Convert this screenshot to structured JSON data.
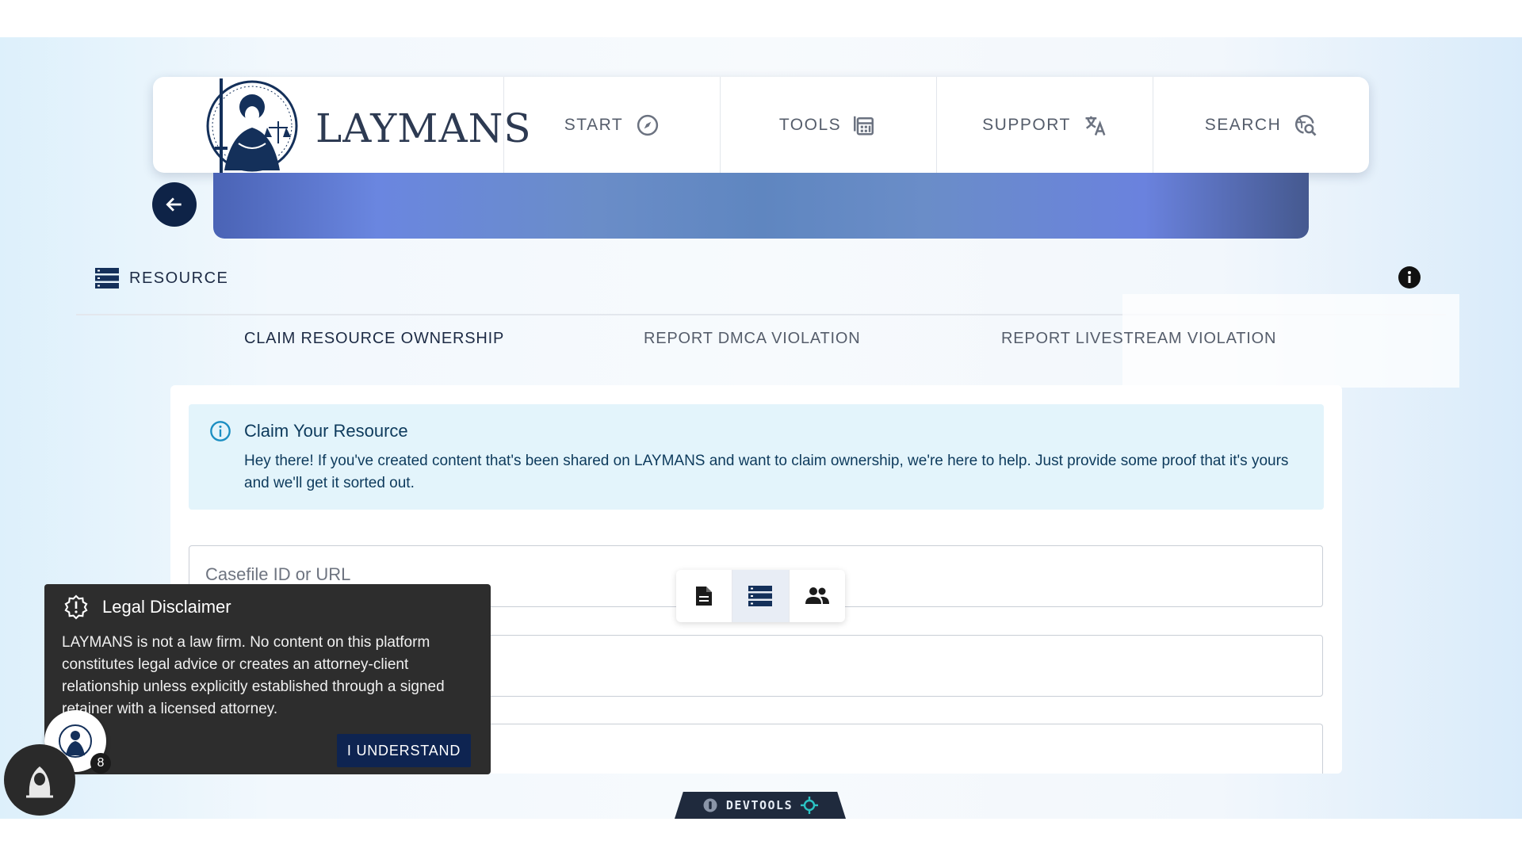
{
  "app": {
    "logo_text": "LAYMANS"
  },
  "nav": [
    {
      "label": "START",
      "icon": "compass-icon"
    },
    {
      "label": "TOOLS",
      "icon": "calculator-icon"
    },
    {
      "label": "SUPPORT",
      "icon": "translate-icon"
    },
    {
      "label": "SEARCH",
      "icon": "search-globe-icon"
    }
  ],
  "resource": {
    "title": "RESOURCE"
  },
  "tabs": [
    {
      "label": "CLAIM RESOURCE OWNERSHIP",
      "active": true
    },
    {
      "label": "REPORT DMCA VIOLATION",
      "active": false
    },
    {
      "label": "REPORT LIVESTREAM VIOLATION",
      "active": false
    }
  ],
  "alert": {
    "title": "Claim Your Resource",
    "body": "Hey there! If you've created content that's been shared on LAYMANS and want to claim ownership, we're here to help. Just provide some proof that it's yours and we'll get it sorted out."
  },
  "form": {
    "casefile_placeholder": "Casefile ID or URL",
    "field2_value": "",
    "field3_value": ""
  },
  "toggle": {
    "options": [
      "document-icon",
      "list-icon",
      "people-icon"
    ],
    "selected": 1
  },
  "disclaimer": {
    "title": "Legal Disclaimer",
    "body": "LAYMANS is not a law firm. No content on this platform constitutes legal advice or creates an attorney-client relationship unless explicitly established through a signed retainer with a licensed attorney.",
    "button": "I UNDERSTAND"
  },
  "notifications": {
    "count": "8"
  },
  "devtools": {
    "label": "DEVTOOLS"
  },
  "colors": {
    "navy": "#0e2347",
    "banner": "#6a86e0",
    "alert_bg": "#e3f4fb"
  }
}
